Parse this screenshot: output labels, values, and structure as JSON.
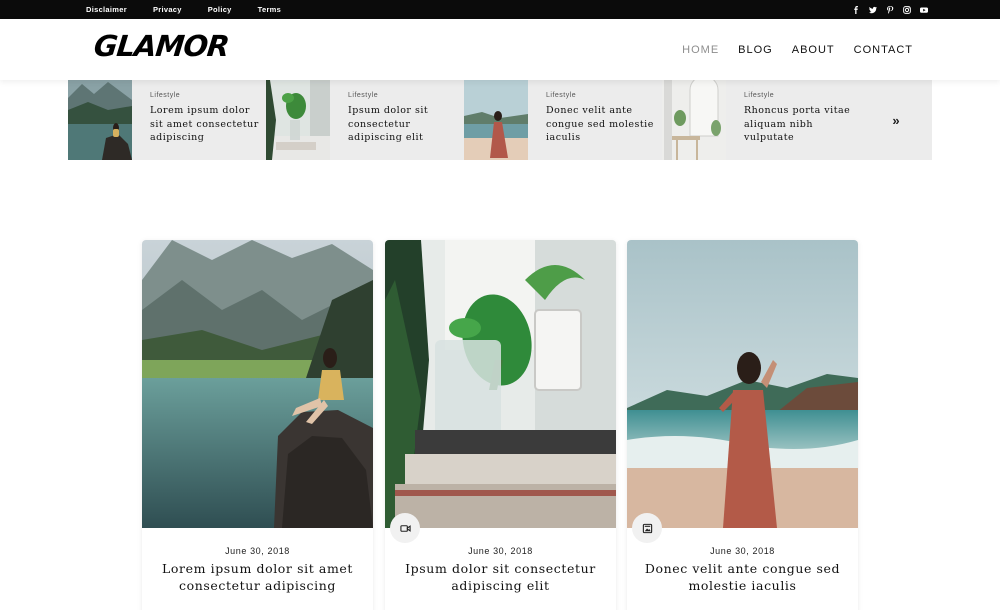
{
  "topbar": {
    "links": [
      "Disclaimer",
      "Privacy",
      "Policy",
      "Terms"
    ],
    "social_icons": [
      "facebook-icon",
      "twitter-icon",
      "pinterest-icon",
      "instagram-icon",
      "youtube-icon"
    ]
  },
  "header": {
    "logo": "GLAMOR",
    "nav": [
      {
        "label": "HOME",
        "active": true
      },
      {
        "label": "BLOG",
        "active": false
      },
      {
        "label": "ABOUT",
        "active": false
      },
      {
        "label": "CONTACT",
        "active": false
      }
    ]
  },
  "featured": {
    "items": [
      {
        "category": "Lifestyle",
        "title": "Lorem ipsum dolor sit amet consectetur adipiscing"
      },
      {
        "category": "Lifestyle",
        "title": "Ipsum dolor sit consectetur adipiscing elit"
      },
      {
        "category": "Lifestyle",
        "title": "Donec velit ante congue sed molestie iaculis"
      },
      {
        "category": "Lifestyle",
        "title": "Rhoncus porta vitae aliquam nibh vulputate"
      }
    ],
    "next_icon": "»"
  },
  "posts": [
    {
      "date": "June 30, 2018",
      "title": "Lorem ipsum dolor sit amet consectetur adipiscing",
      "badge": ""
    },
    {
      "date": "June 30, 2018",
      "title": "Ipsum dolor sit consectetur adipiscing elit",
      "badge": "video-icon"
    },
    {
      "date": "June 30, 2018",
      "title": "Donec velit ante congue sed molestie iaculis",
      "badge": "image-icon"
    }
  ],
  "colors": {
    "topbar_bg": "#0b0b0b",
    "strip_bg": "#ececec",
    "nav_active": "#8e8e8e"
  }
}
